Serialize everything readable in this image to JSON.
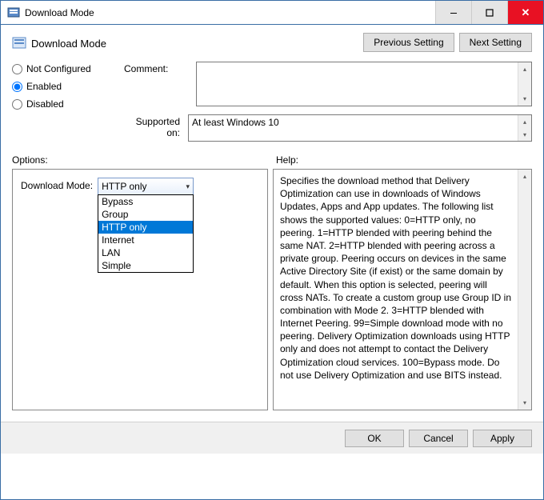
{
  "window": {
    "title": "Download Mode"
  },
  "page": {
    "title": "Download Mode"
  },
  "nav": {
    "previous": "Previous Setting",
    "next": "Next Setting"
  },
  "state": {
    "not_configured": "Not Configured",
    "enabled": "Enabled",
    "disabled": "Disabled",
    "selected": "Enabled"
  },
  "labels": {
    "comment": "Comment:",
    "supported_on": "Supported on:",
    "options": "Options:",
    "help": "Help:",
    "download_mode": "Download Mode:"
  },
  "supported_text": "At least Windows 10",
  "comment_text": "",
  "download_mode": {
    "value": "HTTP only",
    "options": [
      "Bypass",
      "Group",
      "HTTP only",
      "Internet",
      "LAN",
      "Simple"
    ]
  },
  "help_text": "Specifies the download method that Delivery Optimization can use in downloads of Windows Updates, Apps and App updates. The following list shows the supported values: 0=HTTP only, no peering. 1=HTTP blended with peering behind the same NAT. 2=HTTP blended with peering across a private group. Peering occurs on devices in the same Active Directory Site (if exist) or the same domain by default. When this option is selected, peering will cross NATs. To create a custom group use Group ID in combination with Mode 2. 3=HTTP blended with Internet Peering. 99=Simple download mode with no peering. Delivery Optimization downloads using HTTP only and does not attempt to contact the Delivery Optimization cloud services. 100=Bypass mode. Do not use Delivery Optimization and use BITS instead.",
  "footer": {
    "ok": "OK",
    "cancel": "Cancel",
    "apply": "Apply"
  }
}
